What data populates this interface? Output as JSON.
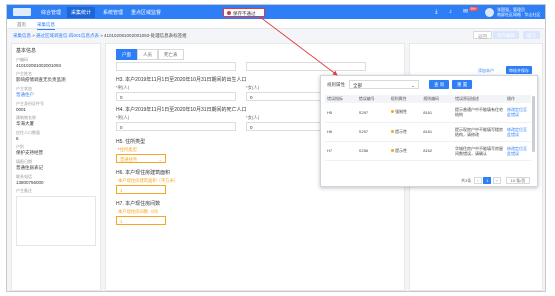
{
  "nav": {
    "items": [
      "综合管理",
      "采集统计",
      "系统管理",
      "重点区域监督"
    ],
    "active_index": 1,
    "alert": "保存不通过",
    "badge": "99+",
    "user_name": "张国强，管理员",
    "user_sub": "南屏社区网格 · 华山社区"
  },
  "tabs": [
    "首页",
    "采集信息"
  ],
  "active_tab": 1,
  "breadcrumb": {
    "link1": "采集信息",
    "sep": " » ",
    "link2": "通过区域调查信-四001信息点表",
    "rest": " » 410102081002001093-处理信息表标签组"
  },
  "top_buttons": {
    "back": "返回",
    "save": "保存编辑",
    "submit": "提交"
  },
  "left_panel": {
    "title": "基本信息",
    "fields": [
      {
        "label": "户编码",
        "value": "410102081002001093",
        "link": false
      },
      {
        "label": "户主姓名",
        "value": "影响疫情调查无负责监测",
        "link": false
      },
      {
        "label": "户主状态",
        "value": "普通住户",
        "link": true
      },
      {
        "label": "户主身份证件号",
        "value": "0001",
        "link": false
      },
      {
        "label": "建筑物名称",
        "value": "华海大厦",
        "link": false
      },
      {
        "label": "应住人口数量",
        "value": "6",
        "link": false
      },
      {
        "label": "户别",
        "value": "保护支持经营",
        "link": false
      },
      {
        "label": "填报日期",
        "value": "普通住居表记",
        "link": false
      },
      {
        "label": "联系电话",
        "value": "13800756000",
        "link": false
      },
      {
        "label": "户主备注",
        "value": "",
        "link": false
      }
    ]
  },
  "form": {
    "seg_tabs": [
      "户面",
      "人员",
      "死亡表"
    ],
    "seg_active": 0,
    "h3_title": "H3. 本户2019年11月1日至2020年10月31日期间的出生人口",
    "h4_title": "H4. 本户2019年11月1日至2020年10月31日期间的死亡人口",
    "male_label": "男(人)",
    "female_label": "女(人)",
    "h3_male": "0",
    "h3_female": "0",
    "h4_male": "0",
    "h4_female": "0",
    "h5_title": "H5. 住所类型",
    "h5_label": "住所类型",
    "h5_value": "普通住宅",
    "h6_title": "H6. 本户现住房建筑面积",
    "h6_label": "本户现住房建筑面积（平方米）",
    "h6_value": "1",
    "h7_title": "H7. 本户现住房间数",
    "h7_label": "本户现住房间数（间）",
    "h7_value": "1"
  },
  "right_panel": {
    "link_text": "添加本户",
    "btn_text": "审核并保存"
  },
  "popup": {
    "filter_label": "规则属性",
    "filter_value": "全部",
    "query_btn": "查 询",
    "reset_btn": "重 置",
    "columns": [
      "错误指标",
      "错误编号",
      "规则属性",
      "规则编码",
      "错误原因描述",
      "操作"
    ],
    "rows": [
      {
        "indicator": "H5",
        "code": "S297",
        "attr": "强制性",
        "rule": "8161",
        "desc": "提示普通户中不能填有住宅结构",
        "op": "修改定位至\n此错误"
      },
      {
        "indicator": "H6",
        "code": "S297",
        "attr": "提示性",
        "rule": "8161",
        "desc": "提示现房户中不能填写楼房结构，请修改",
        "op": "修改定位至\n此错误"
      },
      {
        "indicator": "H7",
        "code": "S256",
        "attr": "提示性",
        "rule": "8162",
        "desc": "华城住房户中不能填写房屋间数错误，请确认",
        "op": "修改定位至\n此错误"
      }
    ],
    "total": "共3条",
    "page": "1",
    "page_size": "10 条/页"
  },
  "accent": "#2d7ef7",
  "alert_color": "#e03a3a",
  "warn_color": "#f5a623"
}
